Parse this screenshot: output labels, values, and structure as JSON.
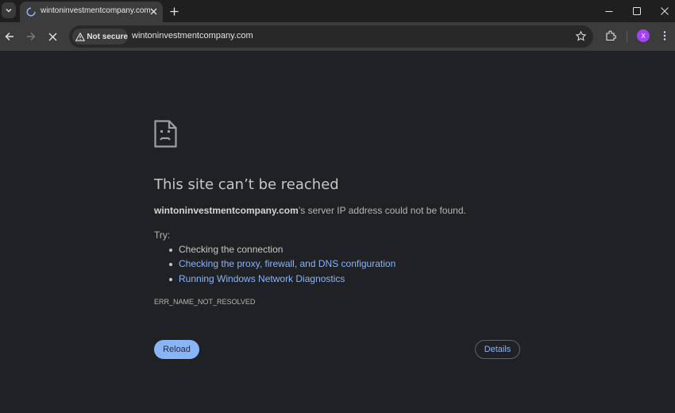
{
  "browser": {
    "tab": {
      "title": "wintoninvestmentcompany.com"
    },
    "omnibox": {
      "security_chip": "Not secure",
      "url": "wintoninvestmentcompany.com"
    },
    "profile_initial": "X",
    "accent_color": "#a142f4"
  },
  "error_page": {
    "icon": "sad-file-icon",
    "heading": "This site can’t be reached",
    "summary_domain": "wintoninvestmentcompany.com",
    "summary_rest": "’s server IP address could not be found.",
    "try_label": "Try:",
    "suggestions": [
      "Checking the connection",
      "Checking the proxy, firewall, and DNS configuration",
      "Running Windows Network Diagnostics"
    ],
    "error_code": "ERR_NAME_NOT_RESOLVED",
    "reload_label": "Reload",
    "details_label": "Details",
    "link_color": "#8ab4f8"
  }
}
